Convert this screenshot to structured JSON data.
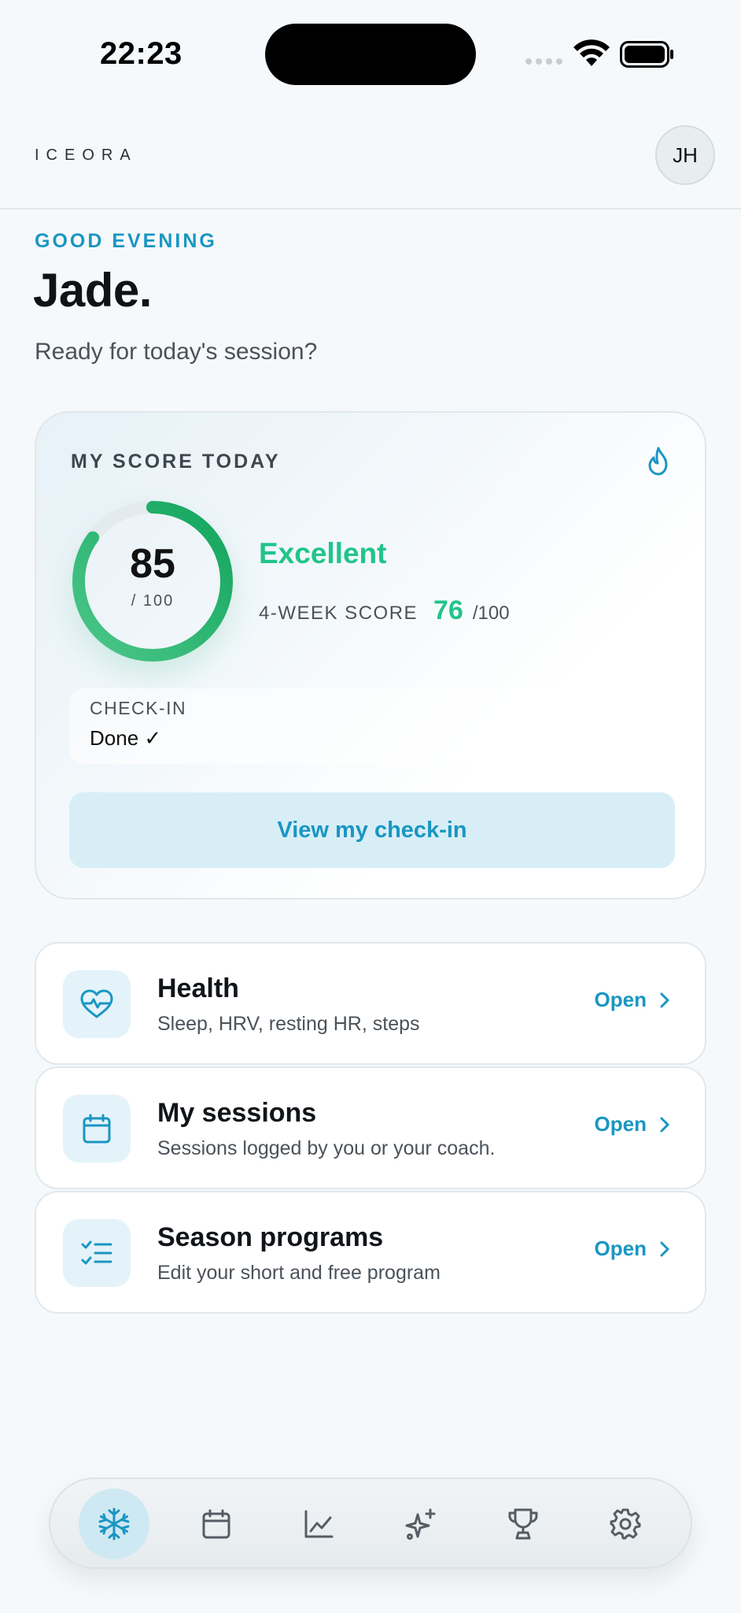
{
  "status_bar": {
    "time": "22:23"
  },
  "header": {
    "logo": "ICEORA",
    "avatar_initials": "JH"
  },
  "greeting": {
    "salutation": "GOOD EVENING",
    "name": "Jade.",
    "subtitle": "Ready for today's session?"
  },
  "score_card": {
    "label": "MY SCORE TODAY",
    "score": "85",
    "score_max": "/ 100",
    "score_fraction": 0.85,
    "rating": "Excellent",
    "four_week_label": "4-WEEK SCORE",
    "four_week_value": "76",
    "four_week_max": "/100",
    "checkin_label": "CHECK-IN",
    "checkin_value": "Done ✓",
    "view_button": "View my check-in"
  },
  "list_items": [
    {
      "title": "Health",
      "subtitle": "Sleep, HRV, resting HR, steps",
      "action": "Open",
      "icon": "heart-pulse-icon"
    },
    {
      "title": "My sessions",
      "subtitle": "Sessions logged by you or your coach.",
      "action": "Open",
      "icon": "calendar-icon"
    },
    {
      "title": "Season programs",
      "subtitle": "Edit your short and free program",
      "action": "Open",
      "icon": "checklist-icon"
    }
  ],
  "bottom_nav": {
    "items": [
      "snowflake-icon",
      "calendar-icon",
      "chart-icon",
      "sparkles-icon",
      "trophy-icon",
      "gear-icon"
    ],
    "active": "snowflake-icon"
  },
  "colors": {
    "accent": "#1a96c2",
    "success": "#22c48a",
    "ring": "#1fb36b",
    "background": "#f6f9fb"
  }
}
